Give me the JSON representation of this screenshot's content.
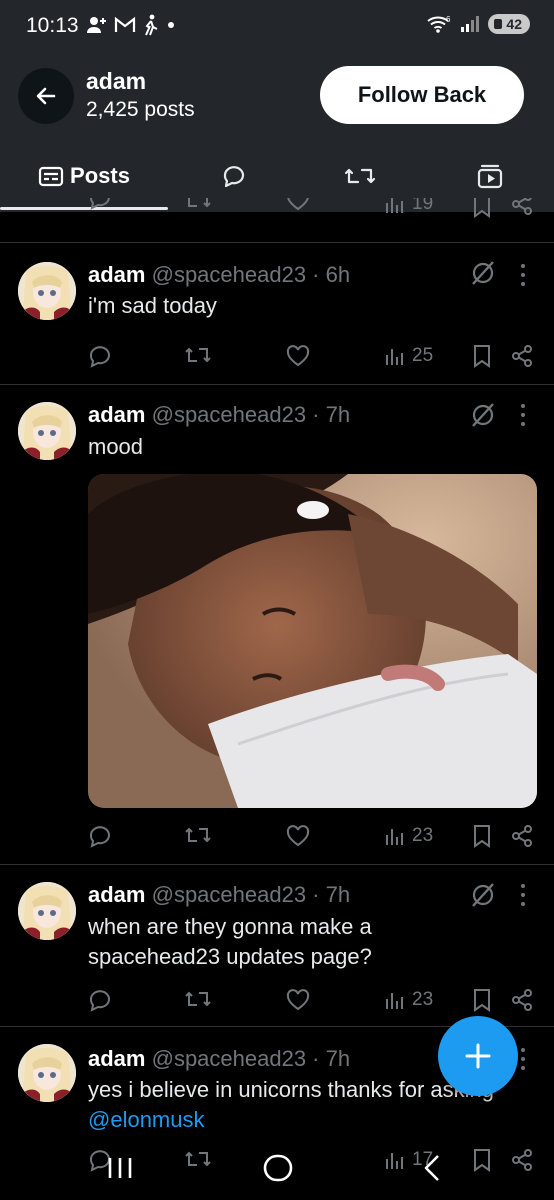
{
  "status_bar": {
    "time": "10:13",
    "battery": "42",
    "signal_badge": "6"
  },
  "header": {
    "name": "adam",
    "posts_count": "2,425 posts",
    "follow_label": "Follow Back"
  },
  "tabs": [
    {
      "label": "Posts"
    }
  ],
  "partial_post": {
    "views": "19"
  },
  "posts": [
    {
      "name": "adam",
      "meta": "@spacehead23 · 6h",
      "text": "i'm sad today",
      "views": "25"
    },
    {
      "name": "adam",
      "meta": "@spacehead23 · 7h",
      "text": "mood",
      "views": "23"
    },
    {
      "name": "adam",
      "meta": "@spacehead23 · 7h",
      "text_lines": [
        "when are they gonna make a",
        "spacehead23 updates page?"
      ],
      "views": "23"
    },
    {
      "name": "adam",
      "meta": "@spacehead23 · 7h",
      "text": "yes i believe in unicorns thanks for asking",
      "mention": "@elonmusk",
      "views": "17"
    }
  ],
  "colors": {
    "accent": "#1d9bf0",
    "bar_bg": "#23272b",
    "muted": "#71767b",
    "bg": "#000000"
  },
  "icons": [
    "back-arrow-icon",
    "reply-icon",
    "repost-icon",
    "like-icon",
    "views-icon",
    "bookmark-icon",
    "share-icon",
    "grok-icon",
    "more-icon",
    "compose-plus-icon"
  ]
}
